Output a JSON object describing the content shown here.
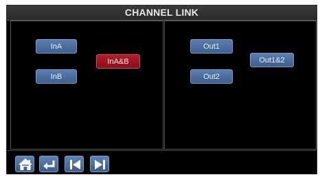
{
  "title": "CHANNEL LINK",
  "inputs": {
    "in_a": "InA",
    "in_b": "InB",
    "in_ab": "InA&B"
  },
  "outputs": {
    "out1": "Out1",
    "out2": "Out2",
    "out12": "Out1&2"
  },
  "nav": {
    "home": "home-icon",
    "back": "return-icon",
    "prev": "skip-previous-icon",
    "next": "skip-next-icon"
  },
  "colors": {
    "button_blue": "#4a6d9c",
    "button_active_red": "#a0141f",
    "background": "#000000"
  }
}
